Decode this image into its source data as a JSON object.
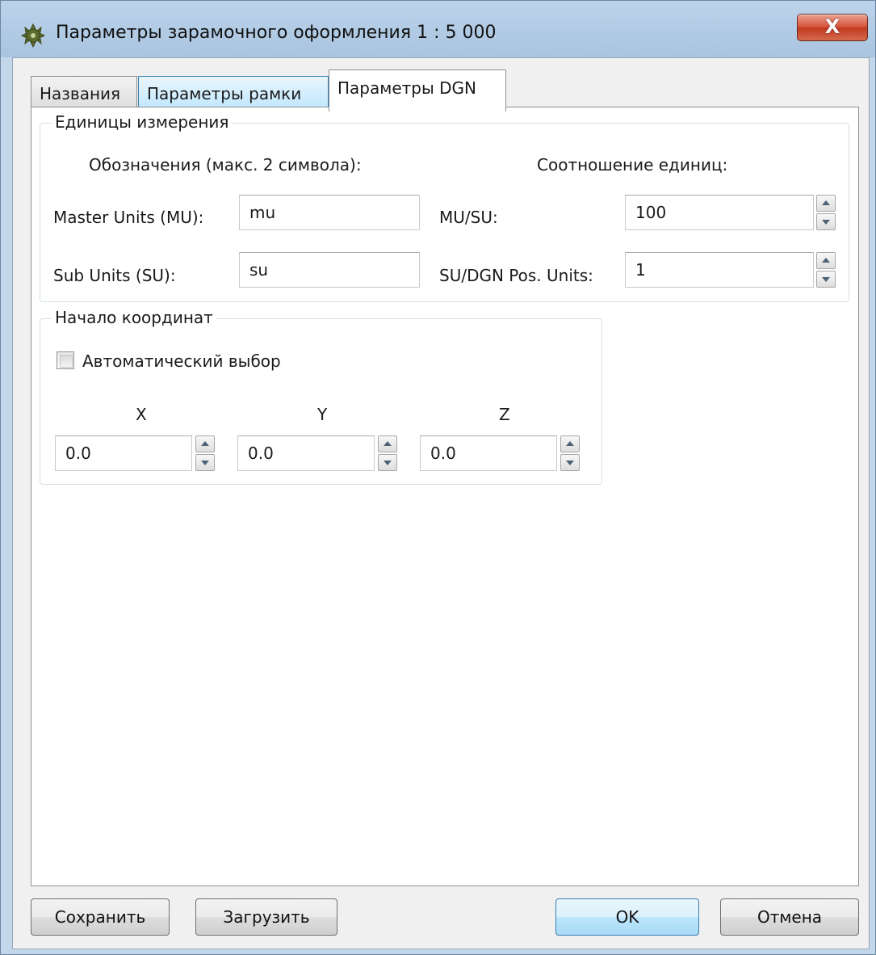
{
  "window": {
    "title": "Параметры зарамочного оформления 1 : 5 000",
    "close_glyph": "X"
  },
  "tabs": [
    {
      "label": "Названия"
    },
    {
      "label": "Параметры рамки"
    },
    {
      "label": "Параметры DGN"
    }
  ],
  "units_group": {
    "title": "Единицы измерения",
    "designations_heading": "Обозначения (макс. 2 символа):",
    "ratio_heading": "Соотношение единиц:",
    "master_label": "Master Units (MU):",
    "master_value": "mu",
    "sub_label": "Sub Units (SU):",
    "sub_value": "su",
    "mu_su_label": "MU/SU:",
    "mu_su_value": "100",
    "su_dgn_label": "SU/DGN Pos. Units:",
    "su_dgn_value": "1"
  },
  "origin_group": {
    "title": "Начало координат",
    "auto_label": "Автоматический выбор",
    "auto_checked": false,
    "x_label": "X",
    "y_label": "Y",
    "z_label": "Z",
    "x_value": "0.0",
    "y_value": "0.0",
    "z_value": "0.0"
  },
  "buttons": {
    "save": "Сохранить",
    "load": "Загрузить",
    "ok": "OK",
    "cancel": "Отмена"
  }
}
